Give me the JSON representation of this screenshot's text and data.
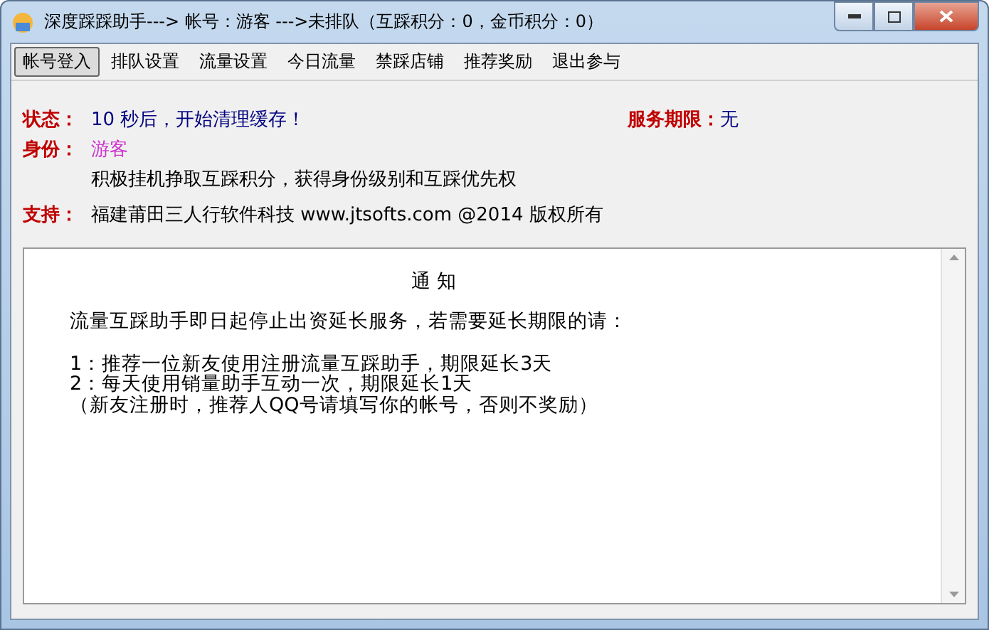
{
  "window": {
    "title": "深度踩踩助手---> 帐号：游客 --->未排队（互踩积分：0，金币积分：0）"
  },
  "menu": [
    {
      "label": "帐号登入",
      "selected": true
    },
    {
      "label": "排队设置",
      "selected": false
    },
    {
      "label": "流量设置",
      "selected": false
    },
    {
      "label": "今日流量",
      "selected": false
    },
    {
      "label": "禁踩店铺",
      "selected": false
    },
    {
      "label": "推荐奖励",
      "selected": false
    },
    {
      "label": "退出参与",
      "selected": false
    }
  ],
  "status": {
    "label": "状态：",
    "value": "10 秒后，开始清理缓存！",
    "expiry_label": "服务期限：",
    "expiry_value": "无"
  },
  "identity": {
    "label": "身份：",
    "value": "游客",
    "hint": "积极挂机挣取互踩积分，获得身份级别和互踩优先权"
  },
  "support": {
    "label": "支持：",
    "value": "福建莆田三人行软件科技 www.jtsofts.com @2014 版权所有"
  },
  "notice": {
    "title": "通 知",
    "lines": [
      "流量互踩助手即日起停止出资延长服务，若需要延长期限的请：",
      "1：推荐一位新友使用注册流量互踩助手，期限延长3天",
      "2：每天使用销量助手互动一次，期限延长1天",
      "（新友注册时，推荐人QQ号请填写你的帐号，否则不奖励）"
    ]
  }
}
